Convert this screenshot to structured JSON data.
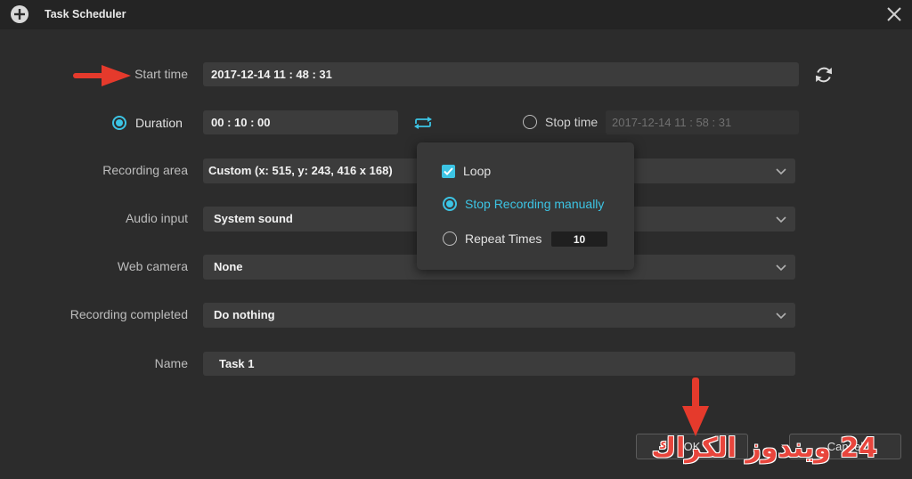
{
  "window": {
    "title": "Task Scheduler"
  },
  "form": {
    "start_time": {
      "label": "Start time",
      "value": "2017-12-14 11 : 48 : 31"
    },
    "duration": {
      "label": "Duration",
      "value": "00 : 10 : 00",
      "selected": true
    },
    "stop_time": {
      "label": "Stop time",
      "value": "2017-12-14 11 : 58 : 31",
      "selected": false
    },
    "recording_area": {
      "label": "Recording area",
      "value": "Custom (x: 515, y: 243, 416 x 168)"
    },
    "audio_input": {
      "label": "Audio input",
      "value": "System sound"
    },
    "web_camera": {
      "label": "Web camera",
      "value": "None"
    },
    "recording_completed": {
      "label": "Recording completed",
      "value": "Do nothing"
    },
    "name": {
      "label": "Name",
      "value": "Task 1"
    }
  },
  "repeat_popup": {
    "loop": {
      "label": "Loop",
      "checked": true
    },
    "stop_manually": {
      "label": "Stop Recording manually",
      "selected": true
    },
    "repeat_times": {
      "label": "Repeat Times",
      "value": "10",
      "selected": false
    }
  },
  "buttons": {
    "ok": "OK",
    "cancel": "Cancel"
  },
  "watermark": {
    "text": "24 ويندوز الكراك"
  },
  "icons": {
    "app": "plus-circle-icon",
    "close": "close-icon",
    "refresh": "refresh-icon",
    "repeat": "loop-icon",
    "dropdown": "chevron-down-icon",
    "check": "checkmark-icon",
    "annotation": "red-arrow-icon"
  },
  "colors": {
    "background": "#2c2c2c",
    "title_bar": "#242424",
    "field": "#3c3c3c",
    "accent": "#3cc4e4",
    "annotation": "#e53a2c",
    "watermark": "#e8453c"
  }
}
